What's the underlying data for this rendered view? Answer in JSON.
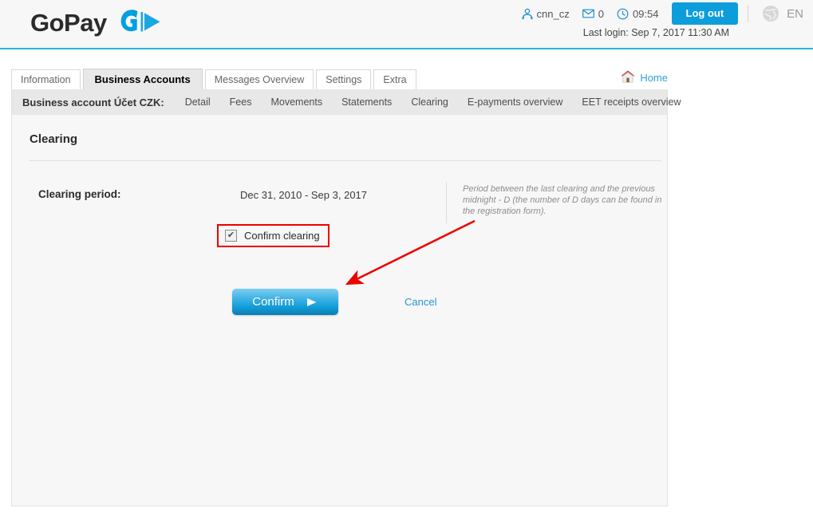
{
  "brand": {
    "name": "GoPay",
    "logo_icon": "gopay-g-play-icon",
    "accent_color": "#0d9ddb",
    "logo_text_color": "#2b2b2b"
  },
  "header": {
    "user": {
      "icon": "user-icon",
      "name": "cnn_cz"
    },
    "messages": {
      "icon": "envelope-icon",
      "count": "0"
    },
    "clock": {
      "icon": "clock-icon",
      "time": "09:54"
    },
    "logout_label": "Log out",
    "language": {
      "icon": "globe-icon",
      "code": "EN"
    },
    "last_login": "Last login: Sep 7, 2017 11:30 AM"
  },
  "tabs": [
    {
      "label": "Information",
      "active": false
    },
    {
      "label": "Business Accounts",
      "active": true
    },
    {
      "label": "Messages Overview",
      "active": false
    },
    {
      "label": "Settings",
      "active": false
    },
    {
      "label": "Extra",
      "active": false
    }
  ],
  "home": {
    "icon": "house-icon",
    "label": "Home"
  },
  "subnav": {
    "title": "Business account Účet CZK:",
    "links": [
      "Detail",
      "Fees",
      "Movements",
      "Statements",
      "Clearing",
      "E-payments overview",
      "EET receipts overview"
    ]
  },
  "main": {
    "page_title": "Clearing",
    "period_label": "Clearing period:",
    "period_value": "Dec 31, 2010  -  Sep 3, 2017",
    "note": "Period between the last clearing and the previous midnight - D (the number of D days can be found in the registration form).",
    "confirm_checkbox": {
      "label": "Confirm clearing",
      "checked": true,
      "check_glyph": "✔",
      "highlight_color": "#ee0000"
    },
    "confirm_button": {
      "label": "Confirm",
      "icon": "play-arrow-icon"
    },
    "cancel_link": "Cancel"
  },
  "annotation": {
    "arrow_color": "#ee0000",
    "arrow_from": "595,278",
    "arrow_to": "432,358"
  }
}
